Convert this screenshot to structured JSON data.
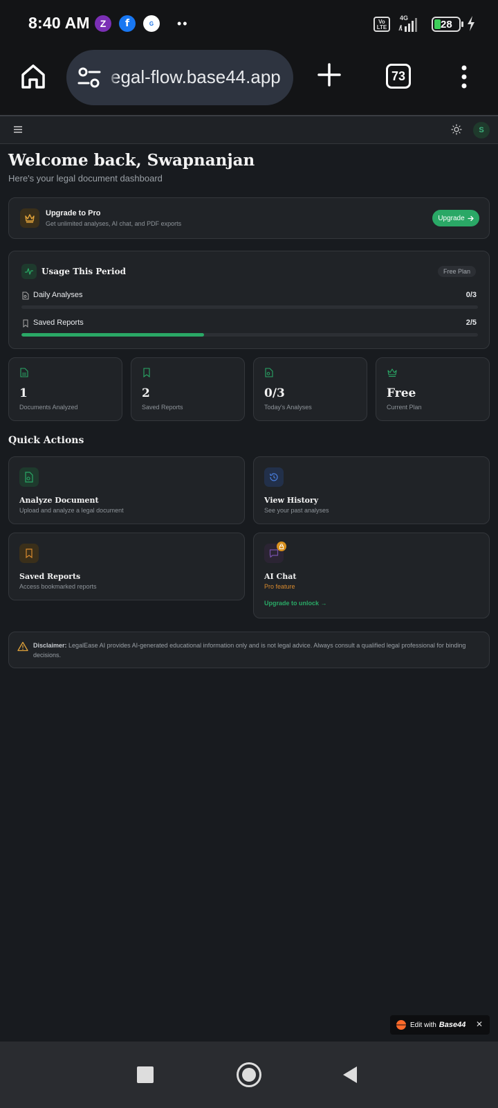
{
  "status_bar": {
    "time": "8:40 AM",
    "network": "4G",
    "volte": "Vo LTE",
    "battery": "28"
  },
  "browser": {
    "url": "egal-flow.base44.app",
    "tab_count": "73"
  },
  "header": {
    "avatar_initial": "S"
  },
  "welcome": {
    "title": "Welcome back, Swapnanjan",
    "subtitle": "Here's your legal document dashboard"
  },
  "upgrade_banner": {
    "title": "Upgrade to Pro",
    "description": "Get unlimited analyses, AI chat, and PDF exports",
    "button_label": "Upgrade"
  },
  "usage": {
    "title": "Usage This Period",
    "plan_badge": "Free Plan",
    "rows": [
      {
        "label": "Daily Analyses",
        "value": "0/3",
        "fraction": 0.0
      },
      {
        "label": "Saved Reports",
        "value": "2/5",
        "fraction": 0.4
      }
    ]
  },
  "stats": [
    {
      "value": "1",
      "label": "Documents Analyzed",
      "icon": "document-icon"
    },
    {
      "value": "2",
      "label": "Saved Reports",
      "icon": "bookmark-icon"
    },
    {
      "value": "0/3",
      "label": "Today's Analyses",
      "icon": "file-search-icon"
    },
    {
      "value": "Free",
      "label": "Current Plan",
      "icon": "crown-icon"
    }
  ],
  "quick_actions": {
    "title": "Quick Actions",
    "items": [
      {
        "title": "Analyze Document",
        "description": "Upload and analyze a legal document"
      },
      {
        "title": "View History",
        "description": "See your past analyses"
      },
      {
        "title": "Saved Reports",
        "description": "Access bookmarked reports"
      },
      {
        "title": "AI Chat",
        "description": "Pro feature",
        "link": "Upgrade to unlock →"
      }
    ]
  },
  "disclaimer": {
    "label": "Disclaimer:",
    "text": "LegalEase AI provides AI-generated educational information only and is not legal advice. Always consult a qualified legal professional for binding decisions."
  },
  "edit_badge": {
    "prefix": "Edit with",
    "brand": "Base44"
  },
  "colors": {
    "accent_green": "#2aa866",
    "pro_orange": "#d88a2e",
    "background": "#181b1f",
    "card": "#202327"
  }
}
